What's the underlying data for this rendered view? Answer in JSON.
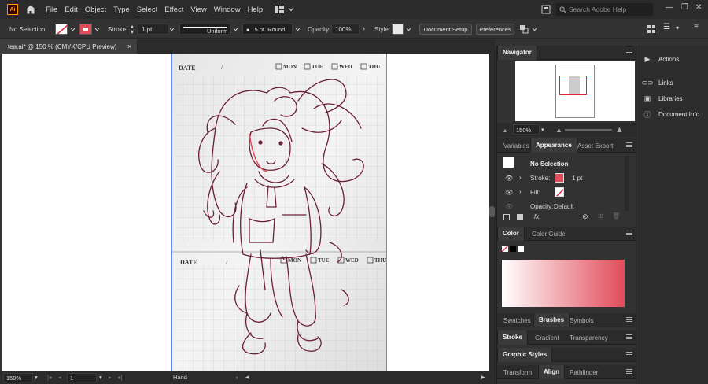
{
  "app": {
    "logo": "Ai"
  },
  "menu": [
    "File",
    "Edit",
    "Object",
    "Type",
    "Select",
    "Effect",
    "View",
    "Window",
    "Help"
  ],
  "search": {
    "placeholder": "Search Adobe Help"
  },
  "control": {
    "selection": "No Selection",
    "stroke_label": "Stroke:",
    "stroke_value": "1 pt",
    "profile": "Uniform",
    "brush": "5 pt. Round",
    "opacity_label": "Opacity:",
    "opacity_value": "100%",
    "style_label": "Style:",
    "doc_setup": "Document Setup",
    "preferences": "Preferences"
  },
  "document": {
    "tab_title": "tea.ai* @ 150 % (CMYK/CPU Preview)",
    "close": "×"
  },
  "artboard": {
    "date_label": "DATE",
    "days_top": [
      "MON",
      "TUE",
      "WED",
      "THU"
    ],
    "days_bottom": [
      "MON",
      "TUE",
      "WED",
      "THU"
    ]
  },
  "status": {
    "zoom": "150%",
    "page": "1",
    "tool": "Hand"
  },
  "navigator": {
    "title": "Navigator",
    "zoom": "150%"
  },
  "appearance_tabs": [
    "Variables",
    "Appearance",
    "Asset Export"
  ],
  "appearance": {
    "selection": "No Selection",
    "stroke_label": "Stroke:",
    "stroke_value": "1 pt",
    "fill_label": "Fill:",
    "opacity_label": "Opacity:",
    "opacity_value": "Default",
    "fx": "fx."
  },
  "color_tabs": [
    "Color",
    "Color Guide"
  ],
  "brush_tabs": [
    "Swatches",
    "Brushes",
    "Symbols"
  ],
  "stroke_tabs": [
    "Stroke",
    "Gradient",
    "Transparency"
  ],
  "graphic_styles": "Graphic Styles",
  "transform_tabs": [
    "Transform",
    "Align",
    "Pathfinder"
  ],
  "dock": [
    "Actions",
    "Links",
    "Libraries",
    "Document Info"
  ],
  "colors": {
    "accent": "#e24b5a",
    "artboard_border": "#5b8cf0",
    "ink": "#6b1f33"
  }
}
